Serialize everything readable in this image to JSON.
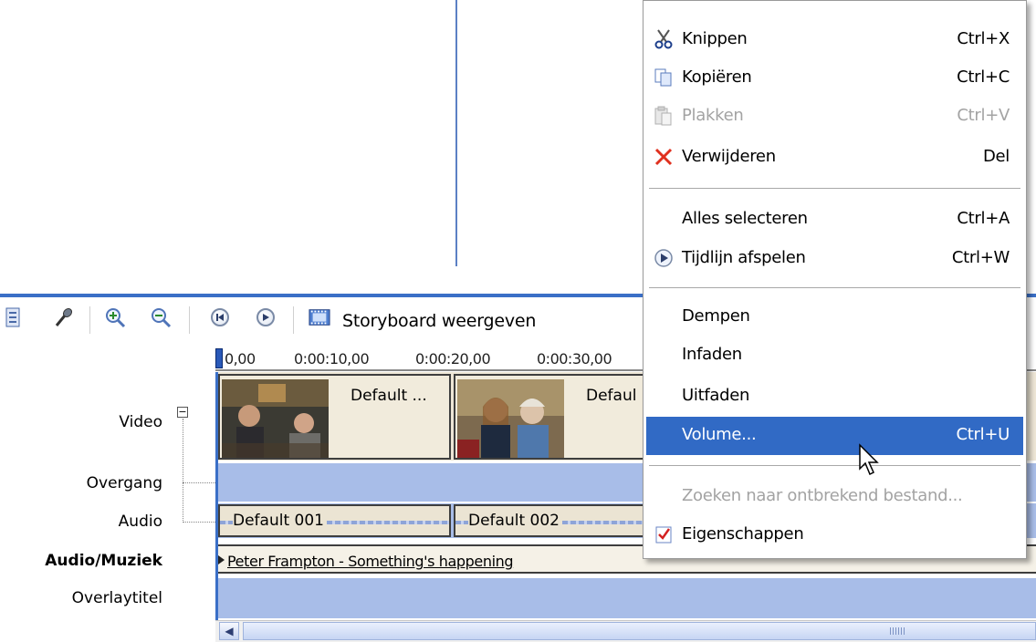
{
  "toolbar": {
    "storyboard_label": "Storyboard weergeven"
  },
  "ruler": {
    "ticks": [
      "0,00",
      "0:00:10,00",
      "0:00:20,00",
      "0:00:30,00"
    ]
  },
  "tracks": {
    "video": "Video",
    "transition": "Overgang",
    "audio": "Audio",
    "audio_music": "Audio/Muziek",
    "overlay_title": "Overlaytitel",
    "collapse_symbol": "−"
  },
  "clips": {
    "video": [
      {
        "title": "Default ..."
      },
      {
        "title": "Defaul"
      }
    ],
    "audio": [
      {
        "title": "Default 001"
      },
      {
        "title": "Default 002"
      }
    ],
    "music": {
      "title": "Peter Frampton - Something's happening"
    }
  },
  "context_menu": {
    "items": [
      {
        "label": "Knippen",
        "shortcut": "Ctrl+X",
        "icon": "scissors-icon",
        "enabled": true
      },
      {
        "label": "Kopiëren",
        "shortcut": "Ctrl+C",
        "icon": "copy-icon",
        "enabled": true
      },
      {
        "label": "Plakken",
        "shortcut": "Ctrl+V",
        "icon": "paste-icon",
        "enabled": false
      },
      {
        "label": "Verwijderen",
        "shortcut": "Del",
        "icon": "delete-x-icon",
        "enabled": true
      },
      {
        "label": "Alles selecteren",
        "shortcut": "Ctrl+A",
        "enabled": true
      },
      {
        "label": "Tijdlijn afspelen",
        "shortcut": "Ctrl+W",
        "icon": "play-circle-icon",
        "enabled": true
      },
      {
        "label": "Dempen",
        "shortcut": "",
        "enabled": true
      },
      {
        "label": "Infaden",
        "shortcut": "",
        "enabled": true
      },
      {
        "label": "Uitfaden",
        "shortcut": "",
        "enabled": true
      },
      {
        "label": "Volume...",
        "shortcut": "Ctrl+U",
        "enabled": true,
        "highlighted": true
      },
      {
        "label": "Zoeken naar ontbrekend bestand...",
        "shortcut": "",
        "enabled": false
      },
      {
        "label": "Eigenschappen",
        "shortcut": "",
        "icon": "properties-check-icon",
        "enabled": true
      }
    ]
  },
  "colors": {
    "accent": "#3a6fc7",
    "menu_highlight": "#316ac5",
    "track_blue": "#a8bde8",
    "disabled_text": "#a3a3a3"
  }
}
